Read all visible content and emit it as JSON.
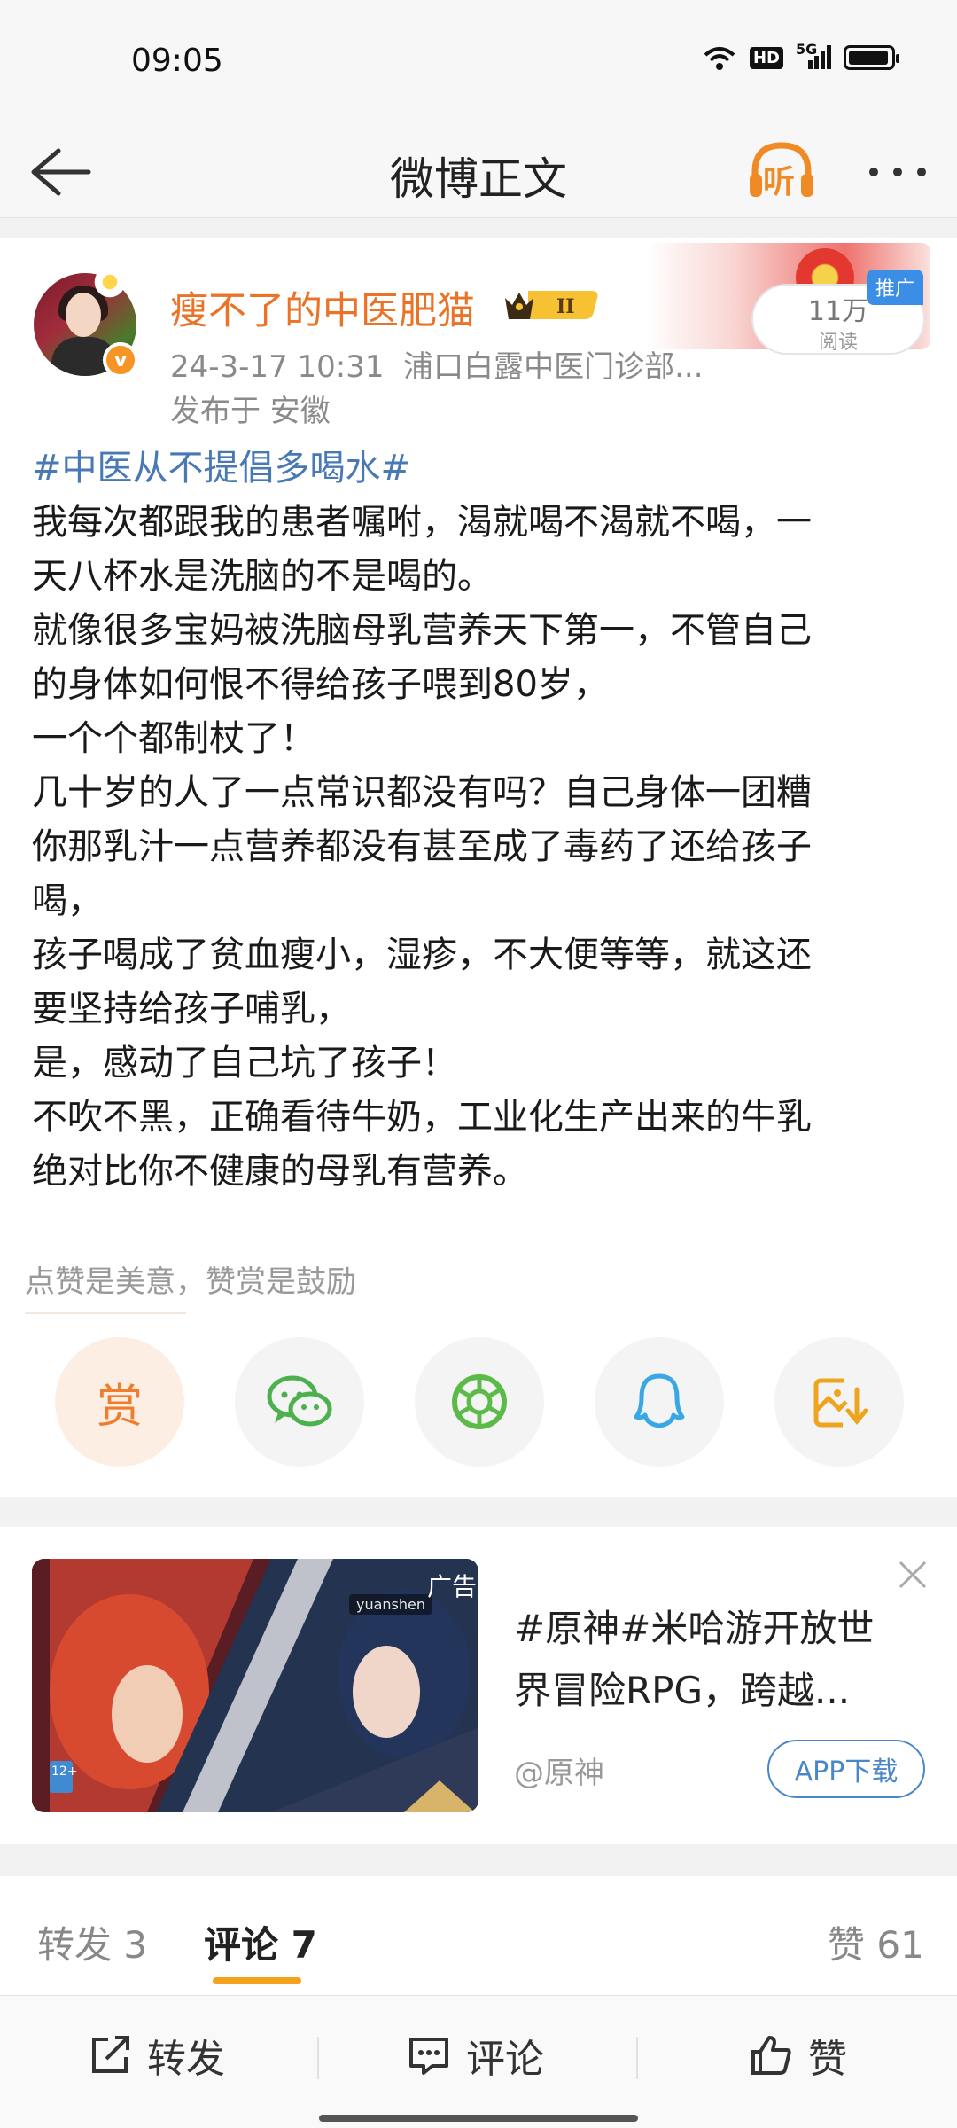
{
  "status_bar": {
    "time": "09:05",
    "hd": "HD",
    "signal": "5G",
    "battery_level": 0.95
  },
  "nav": {
    "title": "微博正文",
    "listen_label": "听"
  },
  "post": {
    "author": "瘦不了的中医肥猫",
    "verified_mark": "v",
    "timestamp": "24-3-17 10:31",
    "source": "浦口白露中医门诊部...",
    "location": "发布于 安徽",
    "reads_count": "11万",
    "reads_label": "阅读",
    "promo_tag": "推广",
    "hashtag": "#中医从不提倡多喝水#",
    "lines": [
      "我每次都跟我的患者嘱咐，渴就喝不渴就不喝，一",
      "天八杯水是洗脑的不是喝的。",
      "就像很多宝妈被洗脑母乳营养天下第一，不管自己",
      "的身体如何恨不得给孩子喂到80岁，",
      "一个个都制杖了！",
      "几十岁的人了一点常识都没有吗？自己身体一团糟",
      "你那乳汁一点营养都没有甚至成了毒药了还给孩子",
      "喝，",
      "孩子喝成了贫血瘦小，湿疹，不大便等等，就这还",
      "要坚持给孩子哺乳，",
      "是，感动了自己坑了孩子！",
      "不吹不黑，正确看待牛奶，工业化生产出来的牛乳",
      "绝对比你不健康的母乳有营养。"
    ],
    "reward_hint": "点赞是美意，赞赏是鼓励",
    "reward_button": "赏"
  },
  "ad": {
    "title_line1": "#原神#米哈游开放世",
    "title_line2": "界冒险RPG，跨越...",
    "source": "@原神",
    "download": "APP下载",
    "ad_label": "广告",
    "game_logo": "yuanshen",
    "age_rating": "12+"
  },
  "tabs": {
    "repost": "转发 3",
    "comment": "评论 7",
    "like": "赞 61"
  },
  "bottom_bar": {
    "repost": "转发",
    "comment": "评论",
    "like": "赞"
  },
  "colors": {
    "username": "#eb7327",
    "hashtag": "#4979b5",
    "tab_underline": "#f4a21c",
    "download_button": "#4a87c7",
    "listen_icon": "#f08a24"
  }
}
